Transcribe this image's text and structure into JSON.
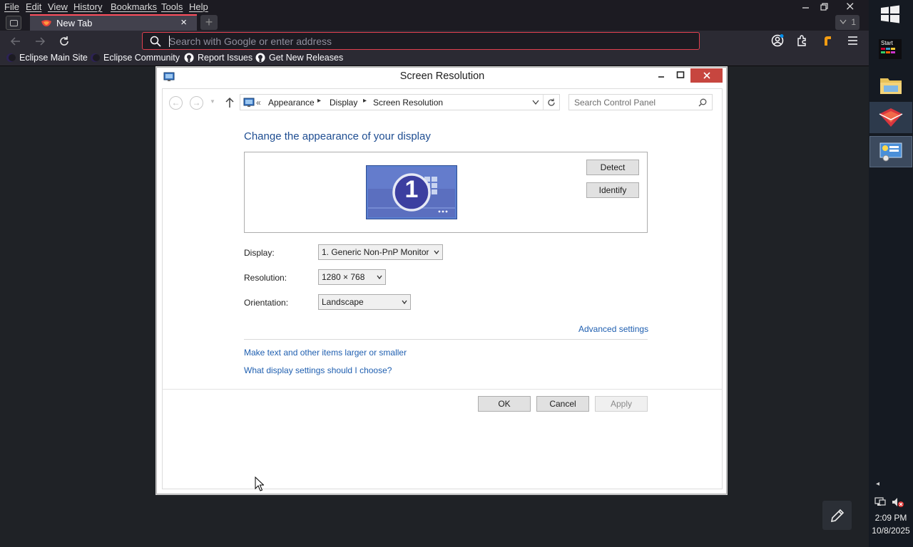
{
  "browser": {
    "menu": [
      "File",
      "Edit",
      "View",
      "History",
      "Bookmarks",
      "Tools",
      "Help"
    ],
    "tab_title": "New Tab",
    "tab_count": "1",
    "address_placeholder": "Search with Google or enter address",
    "bookmarks": [
      "Eclipse Main Site",
      "Eclipse Community",
      "Report Issues",
      "Get New Releases"
    ],
    "accent_color": "#ff4f5e"
  },
  "dialog": {
    "title": "Screen Resolution",
    "breadcrumb": [
      "Appearance",
      "Display",
      "Screen Resolution"
    ],
    "breadcrumb_prefix": "«",
    "search_placeholder": "Search Control Panel",
    "heading": "Change the appearance of your display",
    "monitor_number": "1",
    "detect_label": "Detect",
    "identify_label": "Identify",
    "display_label": "Display:",
    "display_value": "1. Generic Non-PnP Monitor",
    "resolution_label": "Resolution:",
    "resolution_value": "1280 × 768",
    "orientation_label": "Orientation:",
    "orientation_value": "Landscape",
    "advanced_link": "Advanced settings",
    "link_text_size": "Make text and other items larger or smaller",
    "link_choose": "What display settings should I choose?",
    "ok_label": "OK",
    "cancel_label": "Cancel",
    "apply_label": "Apply"
  },
  "taskbar": {
    "start_label": "Start",
    "time": "2:09 PM",
    "date": "10/8/2025"
  }
}
